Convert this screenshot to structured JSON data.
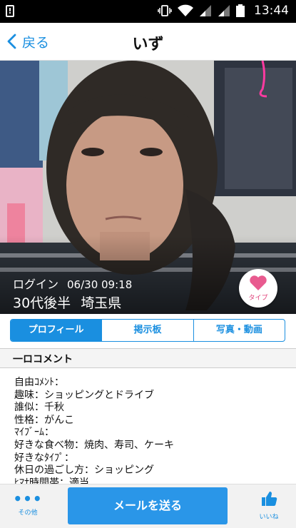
{
  "status_bar": {
    "time": "13:44"
  },
  "nav": {
    "back_label": "戻る",
    "title": "いず"
  },
  "profile": {
    "login_label": "ログイン",
    "login_time": "06/30 09:18",
    "age": "30代後半",
    "prefecture": "埼玉県",
    "type_label": "タイプ"
  },
  "tabs": [
    {
      "label": "プロフィール",
      "active": true
    },
    {
      "label": "掲示板",
      "active": false
    },
    {
      "label": "写真・動画",
      "active": false
    }
  ],
  "comment": {
    "heading": "一ロコメント",
    "lines": [
      "自由ｺﾒﾝﾄ：",
      "趣味：ショッピングとドライブ",
      "誰似：千秋",
      "性格：がんこ",
      "ﾏｲﾌﾞｰﾑ：",
      "好きな食べ物：焼肉、寿司、ケーキ",
      "好きなﾀｲﾌﾟ：",
      "休日の過ごし方：ショッピング",
      "ﾋﾏﾅ時間帯：適当"
    ]
  },
  "bottom_bar": {
    "more_label": "その他",
    "send_label": "メールを送る",
    "like_label": "いいね"
  },
  "colors": {
    "accent": "#1a8fe0",
    "heart": "#e85a8f"
  }
}
